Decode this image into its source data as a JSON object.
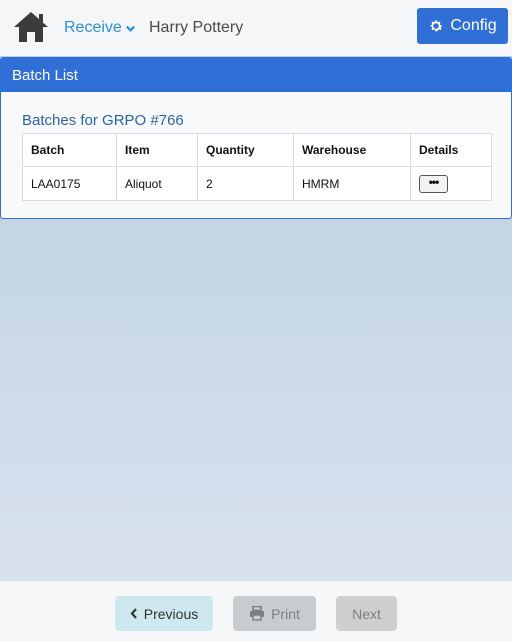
{
  "header": {
    "home_icon": "home-icon",
    "nav_label": "Receive",
    "user_name": "Harry Pottery",
    "config_label": "Config",
    "accent_color": "#2f6fd6"
  },
  "panel": {
    "title": "Batch List",
    "subtitle": "Batches for GRPO #766",
    "columns": [
      "Batch",
      "Item",
      "Quantity",
      "Warehouse",
      "Details"
    ],
    "rows": [
      {
        "batch": "LAA0175",
        "item": "Aliquot",
        "quantity": "2",
        "warehouse": "HMRM",
        "details_label": "•••"
      }
    ]
  },
  "footer": {
    "previous_label": "Previous",
    "print_label": "Print",
    "next_label": "Next"
  }
}
